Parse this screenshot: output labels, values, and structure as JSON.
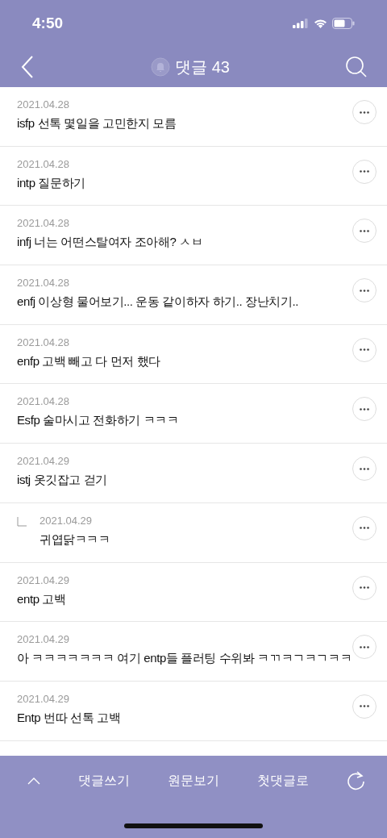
{
  "status_bar": {
    "time": "4:50"
  },
  "header": {
    "title": "댓글 43"
  },
  "comments": [
    {
      "date": "2021.04.28",
      "text": "isfp 선톡 몇일을 고민한지 모름"
    },
    {
      "date": "2021.04.28",
      "text": "intp 질문하기"
    },
    {
      "date": "2021.04.28",
      "text": "infj 너는 어떤스탈여자 조아해? ㅅㅂ"
    },
    {
      "date": "2021.04.28",
      "text": "enfj 이상형 물어보기... 운동 같이하자 하기.. 장난치기.."
    },
    {
      "date": "2021.04.28",
      "text": "enfp 고백 빼고 다 먼저 했다"
    },
    {
      "date": "2021.04.28",
      "text": "Esfp 술마시고 전화하기 ㅋㅋㅋ"
    },
    {
      "date": "2021.04.29",
      "text": "istj 옷깃잡고 걷기",
      "children": [
        {
          "date": "2021.04.29",
          "text": "귀엽닭ㅋㅋㅋ"
        }
      ]
    },
    {
      "date": "2021.04.29",
      "text": "entp 고백"
    },
    {
      "date": "2021.04.29",
      "text": "아 ㅋㅋㅋㅋㅋㅋㅋ 여기 entp들 플러팅 수위봐 ㅋㄲㅋㄱㅋㄱㅋㅋ"
    },
    {
      "date": "2021.04.29",
      "text": "Entp 번따 선톡 고백"
    }
  ],
  "bottom_bar": [
    "댓글쓰기",
    "원문보기",
    "첫댓글로"
  ]
}
